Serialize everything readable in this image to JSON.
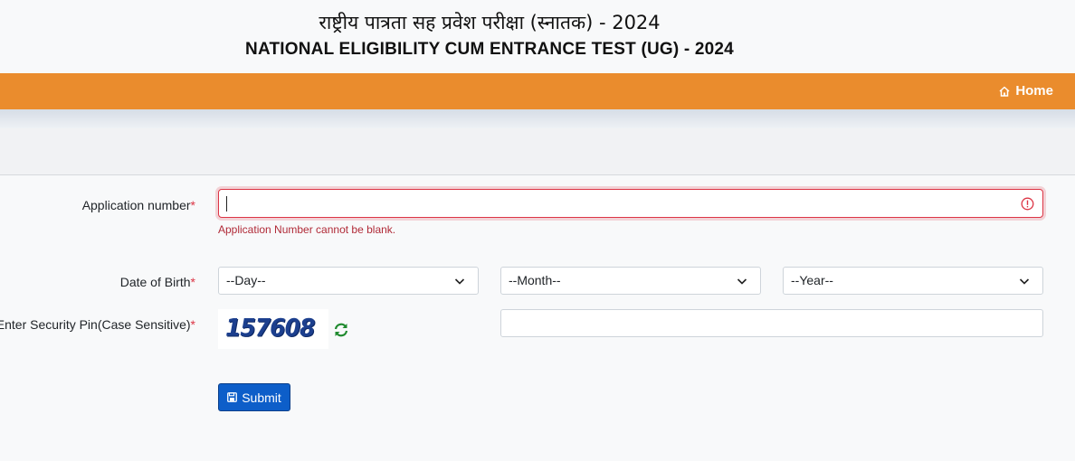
{
  "header": {
    "title_hindi": "राष्ट्रीय पात्रता सह प्रवेश परीक्षा (स्नातक) - 2024",
    "title_english": "NATIONAL ELIGIBILITY CUM ENTRANCE TEST (UG) - 2024"
  },
  "nav": {
    "home_label": "Home",
    "home_icon": "home-icon",
    "bar_color": "#ea8c2d"
  },
  "form": {
    "application_number": {
      "label": "Application number",
      "required_mark": "*",
      "value": "",
      "error": "Application Number cannot be blank."
    },
    "dob": {
      "label": "Date of Birth",
      "required_mark": "*",
      "day": "--Day--",
      "month": "--Month--",
      "year": "--Year--"
    },
    "security_pin": {
      "label": "Enter Security Pin(Case Sensitive)",
      "required_mark": "*",
      "captcha_text": "157608",
      "value": "",
      "refresh_icon": "refresh-icon"
    },
    "submit_label": "Submit",
    "submit_icon": "save-icon",
    "submit_color": "#0d5ec9",
    "error_color": "#dc3545"
  }
}
